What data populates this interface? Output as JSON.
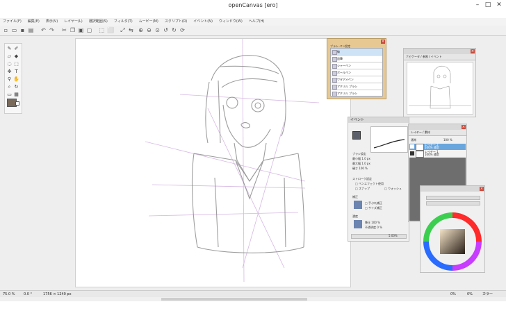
{
  "window": {
    "title": "openCanvas [ero]",
    "min": "–",
    "max": "□",
    "close": "✕"
  },
  "menu": [
    "ファイル(F)",
    "編集(E)",
    "表示(V)",
    "レイヤー(L)",
    "選択範囲(S)",
    "フィルタ(T)",
    "ムービー(M)",
    "スクリプト(R)",
    "イベント(N)",
    "ウィンドウ(W)",
    "ヘルプ(H)"
  ],
  "brush_panel": {
    "tabs": "ブラシ ペン設定",
    "items": [
      "線",
      "鉛筆",
      "シャーペン",
      "ボールペン",
      "ワタアメペン",
      "アクリル ブラシ",
      "アクリル ブラシ",
      "ぼかし"
    ]
  },
  "navigator": {
    "tabs": "ナビゲータ / 参照 / イベント"
  },
  "tool_panel": {
    "tab": "イベント",
    "rows": [
      "ブラシ設定",
      "最小幅 1.0 px",
      "最大幅 1.0 px",
      "硬さ 100 %",
      "ストローク設定",
      "□ ペンエフェクト使用",
      "□ スナップ",
      "□ ウォッシュ",
      "補正",
      "□ 手ぶれ補正",
      "□ サイズ補正",
      "濃度",
      "筆圧 100 %",
      "不透明度 0 %"
    ],
    "zoom": "5.00%"
  },
  "layer_panel": {
    "tabs": "レイヤー / 素材",
    "blend": "通常",
    "opacity": "100 %",
    "layers": [
      {
        "name": "レイヤー 2",
        "info": "100% 通常"
      },
      {
        "name": "レイヤー 1",
        "info": "100% 通常"
      }
    ]
  },
  "status": {
    "zoom": "75.0 %",
    "angle": "0.0 °",
    "size": "1756 × 1240 px",
    "right1": "0%",
    "right2": "0%",
    "right3": "カラー"
  },
  "colors": {
    "canvas": "#ffffff",
    "stroke": "#7a7a7a",
    "guide": "#c59ad8",
    "accent": "#7a6a5a"
  }
}
